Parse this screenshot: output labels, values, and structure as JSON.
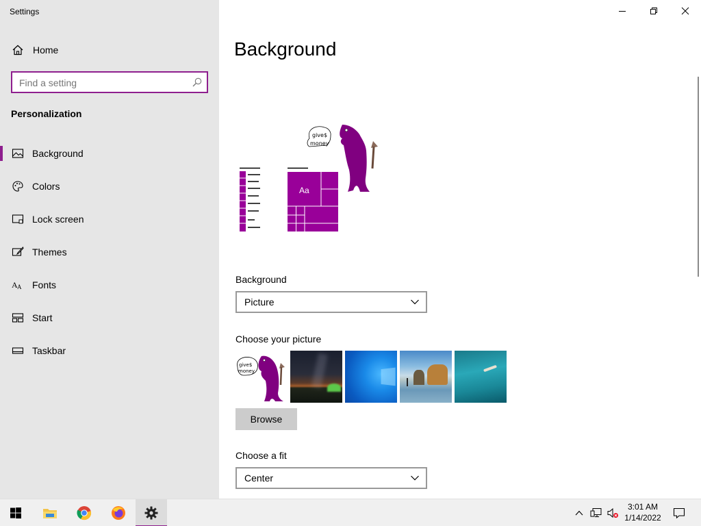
{
  "window": {
    "title": "Settings",
    "minimize_icon": "minimize-icon",
    "maximize_icon": "restore-icon",
    "close_icon": "close-icon"
  },
  "sidebar": {
    "home_label": "Home",
    "search_placeholder": "Find a setting",
    "section_title": "Personalization",
    "items": [
      {
        "label": "Background",
        "icon": "picture-icon",
        "active": true
      },
      {
        "label": "Colors",
        "icon": "palette-icon",
        "active": false
      },
      {
        "label": "Lock screen",
        "icon": "lock-screen-icon",
        "active": false
      },
      {
        "label": "Themes",
        "icon": "brush-icon",
        "active": false
      },
      {
        "label": "Fonts",
        "icon": "fonts-icon",
        "active": false
      },
      {
        "label": "Start",
        "icon": "start-tiles-icon",
        "active": false
      },
      {
        "label": "Taskbar",
        "icon": "taskbar-icon",
        "active": false
      }
    ]
  },
  "main": {
    "page_title": "Background",
    "preview": {
      "tile_label": "Aa",
      "speech_line1": "give$",
      "speech_line2": "money"
    },
    "background_label": "Background",
    "background_value": "Picture",
    "choose_picture_label": "Choose your picture",
    "thumbnails": [
      {
        "name": "purple-creature",
        "speech_line1": "give$",
        "speech_line2": "money"
      },
      {
        "name": "night-sky-tent"
      },
      {
        "name": "windows-blue"
      },
      {
        "name": "beach-rocks"
      },
      {
        "name": "underwater-swimmer"
      }
    ],
    "browse_label": "Browse",
    "fit_label": "Choose a fit",
    "fit_value": "Center"
  },
  "taskbar": {
    "apps": [
      "windows-start-icon",
      "file-explorer-icon",
      "chrome-icon",
      "firefox-icon",
      "settings-gear-icon"
    ],
    "tray": [
      "chevron-up-icon",
      "network-icon",
      "volume-muted-icon",
      "notification-icon"
    ],
    "time": "3:01 AM",
    "date": "1/14/2022"
  },
  "colors": {
    "accent": "#8e1e8e",
    "tile": "#990099",
    "sidebar_bg": "#e6e6e6",
    "taskbar_bg": "#f0f0f0"
  }
}
